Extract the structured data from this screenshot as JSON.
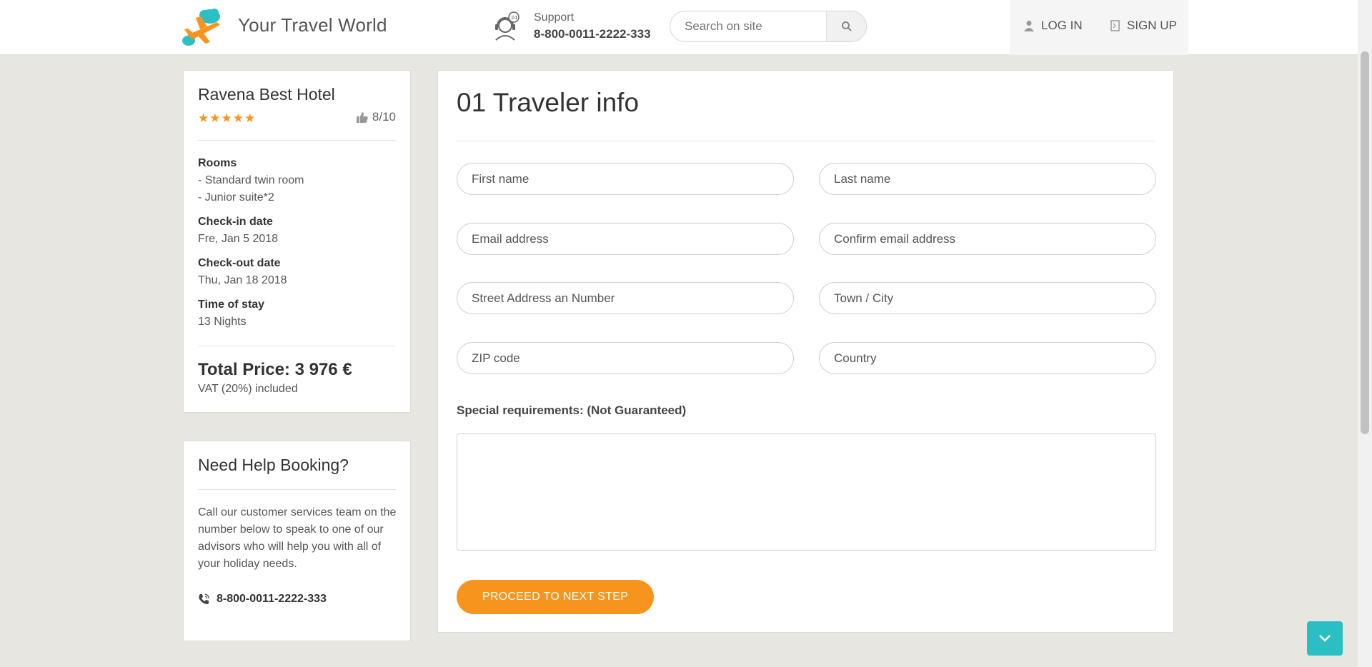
{
  "header": {
    "brand": "Your Travel World",
    "support_label": "Support",
    "support_phone": "8-800-0011-2222-333",
    "search_placeholder": "Search on site",
    "login_label": "LOG IN",
    "signup_label": "SIGN UP"
  },
  "booking": {
    "hotel_name": "Ravena Best Hotel",
    "stars": "★★★★★",
    "star_rating": 5,
    "rating": "8/10",
    "rooms_label": "Rooms",
    "rooms": [
      "- Standard twin room",
      "- Junior suite*2"
    ],
    "checkin_label": "Check-in date",
    "checkin_value": "Fre, Jan 5 2018",
    "checkout_label": "Check-out date",
    "checkout_value": "Thu, Jan 18 2018",
    "stay_label": "Time of stay",
    "stay_value": "13 Nights",
    "total_price": "Total Price: 3 976 €",
    "vat": "VAT (20%) included"
  },
  "help": {
    "title": "Need Help Booking?",
    "text": "Call our customer services team on the number below to speak to one of our advisors who will help you with all of your holiday needs.",
    "phone": "8-800-0011-2222-333"
  },
  "form": {
    "title": "01 Traveler info",
    "first_name": "First name",
    "last_name": "Last name",
    "email": "Email address",
    "confirm_email": "Confirm email address",
    "street": "Street Address an Number",
    "town": "Town / City",
    "zip": "ZIP code",
    "country": "Country",
    "special_label": "Special requirements: (Not Guaranteed)",
    "proceed_label": "PROCEED TO NEXT STEP"
  },
  "colors": {
    "accent_orange": "#f7941d",
    "accent_teal": "#2bbfc4",
    "background": "#e8e6e1"
  },
  "icons": [
    "plane-cloud-logo-icon",
    "support-agent-icon",
    "search-icon",
    "user-icon",
    "signup-door-icon",
    "thumbs-up-icon",
    "phone-icon",
    "chevron-down-icon"
  ]
}
